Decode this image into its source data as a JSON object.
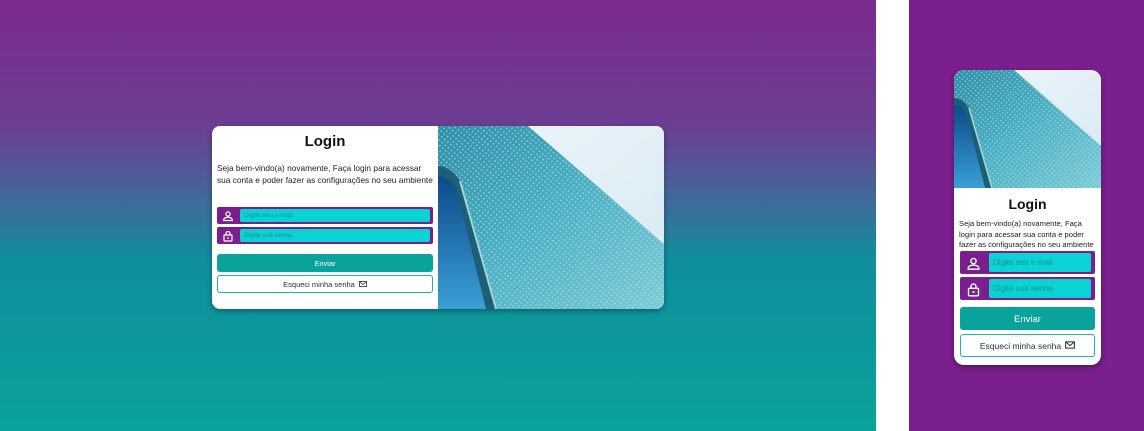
{
  "login": {
    "title": "Login",
    "intro": "Seja bem-vindo(a) novamente, Faça login para acessar sua conta e poder fazer as configurações no seu ambiente",
    "email_placeholder": "Digite seu e-mail",
    "password_placeholder": "Digite sua senha",
    "submit_label": "Enviar",
    "forgot_label": "Esqueci minha senha"
  },
  "icons": {
    "user": "user-icon",
    "lock": "lock-icon",
    "mail": "mail-icon"
  },
  "colors": {
    "purple": "#7a1f8d",
    "teal": "#0aa39c",
    "input_cyan": "#0bd3d4",
    "outline": "#22b3b3"
  }
}
